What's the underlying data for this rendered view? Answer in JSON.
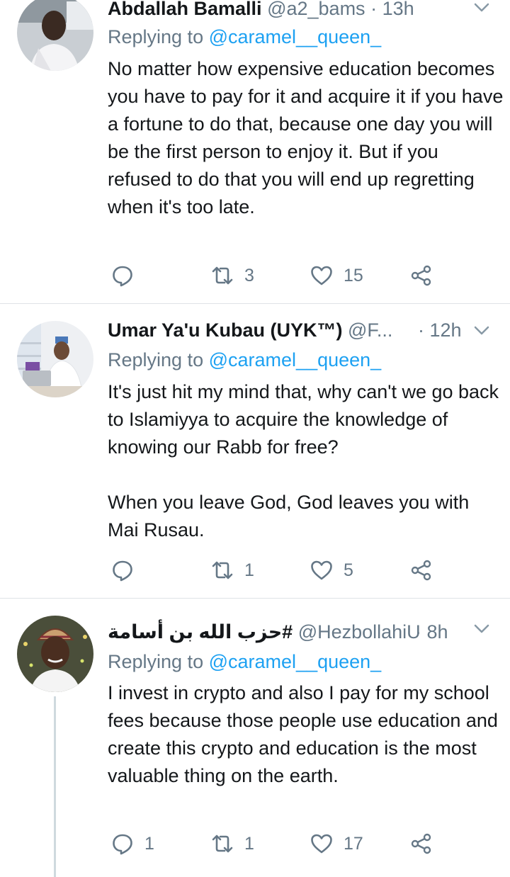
{
  "colors": {
    "accent": "#1da1f2",
    "secondary": "#657786",
    "divider": "#dfe3e7"
  },
  "tweets": [
    {
      "name": "Abdallah Bamalli",
      "handle": "@a2_bams",
      "time": "· 13h",
      "replying_label": "Replying to",
      "replying_to": "@caramel__queen_",
      "paragraphs": [
        "No matter how expensive education becomes you have to pay for it and acquire it if you have a fortune to do that, because one day you will be the first person to enjoy it. But if you refused to do that you will end up regretting when it's too late."
      ],
      "reply_count": "",
      "retweet_count": "3",
      "like_count": "15"
    },
    {
      "name": "Umar Ya'u Kubau (UYK™)",
      "handle": "@F...",
      "time": "· 12h",
      "replying_label": "Replying to",
      "replying_to": "@caramel__queen_",
      "paragraphs": [
        "It's just hit my mind that, why can't we go back to Islamiyya to acquire the knowledge of knowing our Rabb for free?",
        "When you leave God, God leaves you with Mai Rusau."
      ],
      "reply_count": "",
      "retweet_count": "1",
      "like_count": "5"
    },
    {
      "name": "#حزب الله بن أسامة",
      "handle": "@HezbollahiU",
      "time": "· 8h",
      "replying_label": "Replying to",
      "replying_to": "@caramel__queen_",
      "paragraphs": [
        "I invest in crypto and also I pay for my school fees because those people use education and create this crypto and education is the most valuable thing on the earth."
      ],
      "reply_count": "1",
      "retweet_count": "1",
      "like_count": "17"
    }
  ]
}
